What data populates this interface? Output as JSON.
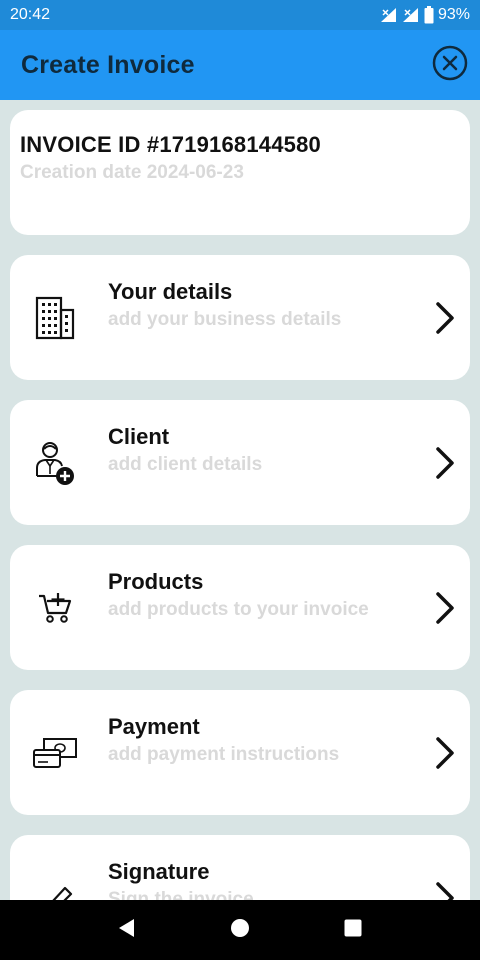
{
  "status_bar": {
    "time": "20:42",
    "battery": "93%",
    "icons": [
      "signal-icon",
      "signal-icon",
      "battery-icon"
    ]
  },
  "app_bar": {
    "title": "Create Invoice",
    "close_icon": "close-circle-icon"
  },
  "invoice": {
    "id_label": "INVOICE ID #1719168144580",
    "creation_date": "Creation date 2024-06-23"
  },
  "sections": [
    {
      "title": "Your details",
      "subtitle": "add your business details",
      "icon": "building-icon"
    },
    {
      "title": "Client",
      "subtitle": "add client details",
      "icon": "add-client-icon"
    },
    {
      "title": "Products",
      "subtitle": "add products to your invoice",
      "icon": "cart-add-icon"
    },
    {
      "title": "Payment",
      "subtitle": "add payment instructions",
      "icon": "payment-icon"
    },
    {
      "title": "Signature",
      "subtitle": "Sign the invoice",
      "icon": "pen-icon"
    }
  ],
  "nav_bar": {
    "icons": [
      "back-icon",
      "home-icon",
      "recents-icon"
    ]
  },
  "colors": {
    "status_bar": "#1f8ad8",
    "app_bar": "#2196f3",
    "background": "#d8e4e4",
    "card": "#ffffff",
    "subtitle": "#d9d9d9"
  }
}
